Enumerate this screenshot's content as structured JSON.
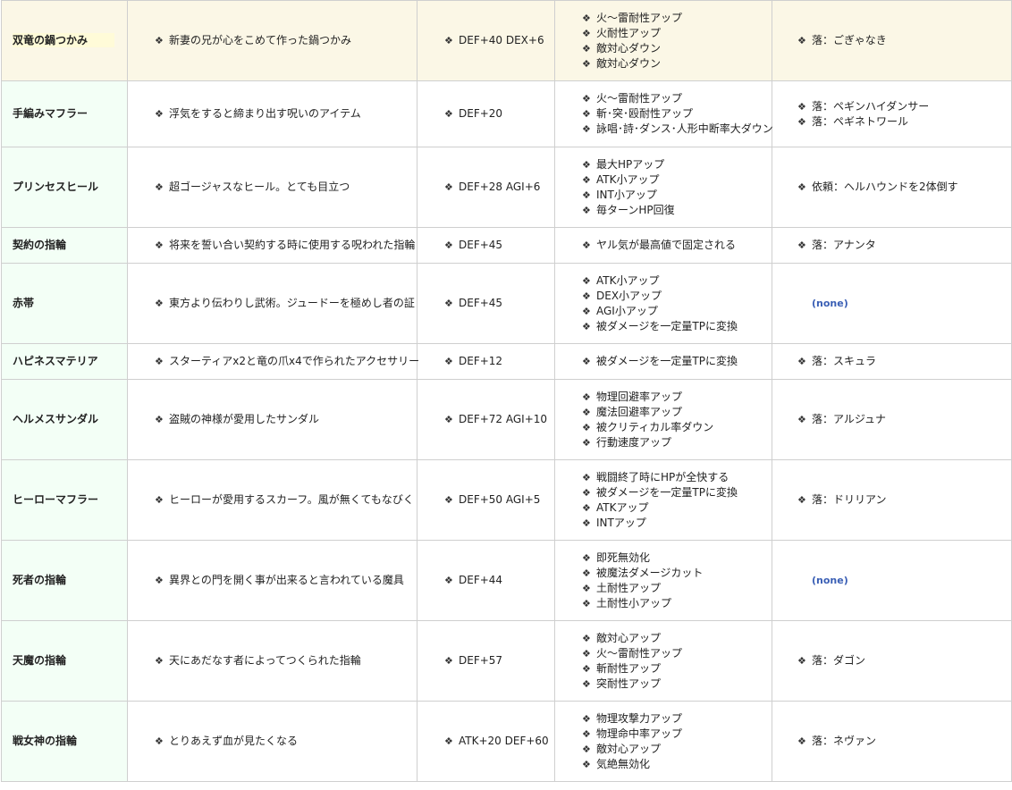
{
  "bullet": "❖",
  "rows": [
    {
      "name": "双竜の鍋つかみ",
      "desc": "新妻の兄が心をこめて作った鍋つかみ",
      "stat": "DEF+40 DEX+6",
      "effects": [
        "火～雷耐性アップ",
        "火耐性アップ",
        "敵対心ダウン",
        "敵対心ダウン"
      ],
      "sources": [
        "落：ごぎゃなき"
      ]
    },
    {
      "name": "手編みマフラー",
      "desc": "浮気をすると締まり出す呪いのアイテム",
      "stat": "DEF+20",
      "effects": [
        "火～雷耐性アップ",
        "斬･突･殴耐性アップ",
        "詠唱･詩･ダンス･人形中断率大ダウン"
      ],
      "sources": [
        "落：ペギンハイダンサー",
        "落：ペギネトワール"
      ]
    },
    {
      "name": "プリンセスヒール",
      "desc": "超ゴージャスなヒール。とても目立つ",
      "stat": "DEF+28 AGI+6",
      "effects": [
        "最大HPアップ",
        "ATK小アップ",
        "INT小アップ",
        "毎ターンHP回復"
      ],
      "sources": [
        "依頼：ヘルハウンドを2体倒す"
      ]
    },
    {
      "name": "契約の指輪",
      "desc": "将来を誓い合い契約する時に使用する呪われた指輪",
      "stat": "DEF+45",
      "effects": [
        "ヤル気が最高値で固定される"
      ],
      "sources": [
        "落：アナンタ"
      ]
    },
    {
      "name": "赤帯",
      "desc": "東方より伝わりし武術。ジュードーを極めし者の証",
      "stat": "DEF+45",
      "effects": [
        "ATK小アップ",
        "DEX小アップ",
        "AGI小アップ",
        "被ダメージを一定量TPに変換"
      ],
      "sources": [],
      "none": "(none)"
    },
    {
      "name": "ハピネスマテリア",
      "desc": "スターティアx2と竜の爪x4で作られたアクセサリー",
      "stat": "DEF+12",
      "effects": [
        "被ダメージを一定量TPに変換"
      ],
      "sources": [
        "落：スキュラ"
      ]
    },
    {
      "name": "ヘルメスサンダル",
      "desc": "盗賊の神様が愛用したサンダル",
      "stat": "DEF+72 AGI+10",
      "effects": [
        "物理回避率アップ",
        "魔法回避率アップ",
        "被クリティカル率ダウン",
        "行動速度アップ"
      ],
      "sources": [
        "落：アルジュナ"
      ]
    },
    {
      "name": "ヒーローマフラー",
      "desc": "ヒーローが愛用するスカーフ。風が無くてもなびく",
      "stat": "DEF+50 AGI+5",
      "effects": [
        "戦闘終了時にHPが全快する",
        "被ダメージを一定量TPに変換",
        "ATKアップ",
        "INTアップ"
      ],
      "sources": [
        "落：ドリリアン"
      ]
    },
    {
      "name": "死者の指輪",
      "desc": "異界との門を開く事が出来ると言われている魔具",
      "stat": "DEF+44",
      "effects": [
        "即死無効化",
        "被魔法ダメージカット",
        "土耐性アップ",
        "土耐性小アップ"
      ],
      "sources": [],
      "none": "(none)"
    },
    {
      "name": "天魔の指輪",
      "desc": "天にあだなす者によってつくられた指輪",
      "stat": "DEF+57",
      "effects": [
        "敵対心アップ",
        "火～雷耐性アップ",
        "斬耐性アップ",
        "突耐性アップ"
      ],
      "sources": [
        "落：ダゴン"
      ]
    },
    {
      "name": "戦女神の指輪",
      "desc": "とりあえず血が見たくなる",
      "stat": "ATK+20 DEF+60",
      "effects": [
        "物理攻撃力アップ",
        "物理命中率アップ",
        "敵対心アップ",
        "気絶無効化"
      ],
      "sources": [
        "落：ネヴァン"
      ]
    }
  ]
}
